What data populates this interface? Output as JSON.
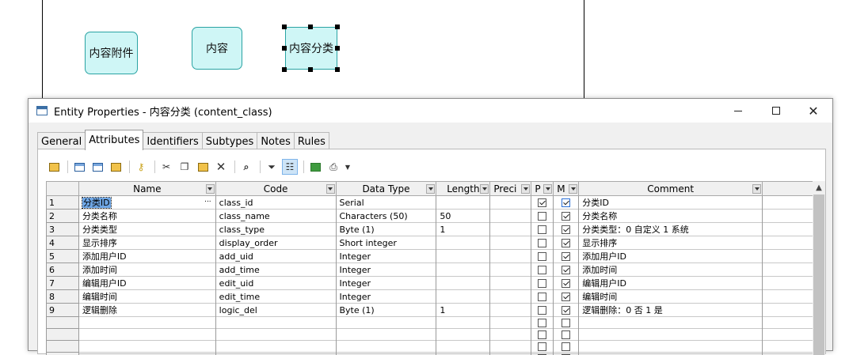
{
  "diagram": {
    "entities": [
      "内容附件",
      "内容",
      "内容分类"
    ]
  },
  "window": {
    "title": "Entity Properties - 内容分类 (content_class)",
    "minimize_icon": "minimize-icon",
    "maximize_icon": "maximize-icon",
    "close_icon": "close-icon"
  },
  "tabs": [
    "General",
    "Attributes",
    "Identifiers",
    "Subtypes",
    "Notes",
    "Rules"
  ],
  "active_tab": "Attributes",
  "toolbar": {
    "icons": [
      "properties-icon",
      "insert-row-icon",
      "add-row-icon",
      "add-attributes-icon",
      "key-icon",
      "cut-icon",
      "copy-icon",
      "paste-icon",
      "delete-icon",
      "find-icon",
      "filter-icon",
      "customize-columns-icon",
      "excel-export-icon",
      "print-icon",
      "dropdown-arrow-icon"
    ]
  },
  "grid": {
    "columns": [
      "Name",
      "Code",
      "Data Type",
      "Length",
      "Preci",
      "P",
      "M",
      "Comment"
    ],
    "rows": [
      {
        "num": "1",
        "name": "分类ID",
        "code": "class_id",
        "type": "Serial",
        "length": "",
        "p": true,
        "m": true,
        "comment": "分类ID"
      },
      {
        "num": "2",
        "name": "分类名称",
        "code": "class_name",
        "type": "Characters (50)",
        "length": "50",
        "p": false,
        "m": true,
        "comment": "分类名称"
      },
      {
        "num": "3",
        "name": "分类类型",
        "code": "class_type",
        "type": "Byte (1)",
        "length": "1",
        "p": false,
        "m": true,
        "comment": "分类类型：0 自定义 1 系统"
      },
      {
        "num": "4",
        "name": "显示排序",
        "code": "display_order",
        "type": "Short integer",
        "length": "",
        "p": false,
        "m": true,
        "comment": "显示排序"
      },
      {
        "num": "5",
        "name": "添加用户ID",
        "code": "add_uid",
        "type": "Integer",
        "length": "",
        "p": false,
        "m": true,
        "comment": "添加用户ID"
      },
      {
        "num": "6",
        "name": "添加时间",
        "code": "add_time",
        "type": "Integer",
        "length": "",
        "p": false,
        "m": true,
        "comment": "添加时间"
      },
      {
        "num": "7",
        "name": "编辑用户ID",
        "code": "edit_uid",
        "type": "Integer",
        "length": "",
        "p": false,
        "m": true,
        "comment": "编辑用户ID"
      },
      {
        "num": "8",
        "name": "编辑时间",
        "code": "edit_time",
        "type": "Integer",
        "length": "",
        "p": false,
        "m": true,
        "comment": "编辑时间"
      },
      {
        "num": "9",
        "name": "逻辑删除",
        "code": "logic_del",
        "type": "Byte (1)",
        "length": "1",
        "p": false,
        "m": true,
        "comment": "逻辑删除：0 否 1 是"
      }
    ],
    "selected_cell_ellipsis": "..."
  }
}
